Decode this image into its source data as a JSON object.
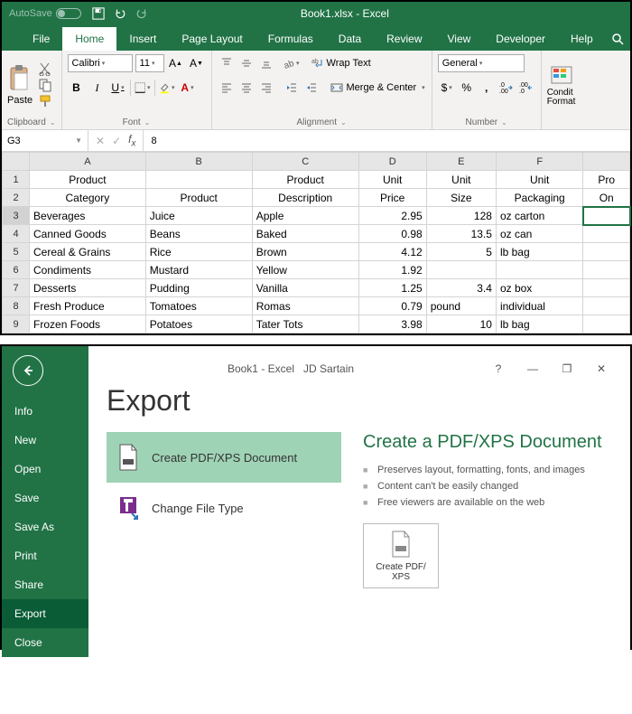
{
  "titlebar": {
    "autosave": "AutoSave",
    "title": "Book1.xlsx - Excel"
  },
  "tabs": [
    "File",
    "Home",
    "Insert",
    "Page Layout",
    "Formulas",
    "Data",
    "Review",
    "View",
    "Developer",
    "Help"
  ],
  "active_tab": "Home",
  "ribbon": {
    "clipboard": {
      "paste": "Paste",
      "label": "Clipboard"
    },
    "font": {
      "name": "Calibri",
      "size": "11",
      "b": "B",
      "i": "I",
      "u": "U",
      "label": "Font"
    },
    "alignment": {
      "wrap": "Wrap Text",
      "merge": "Merge & Center",
      "label": "Alignment"
    },
    "number": {
      "format": "General",
      "currency": "$",
      "percent": "%",
      "comma": ",",
      "inc": ".0→",
      "dec": "→.0",
      "label": "Number"
    },
    "styles": {
      "condfmt": "Condit\nFormat"
    }
  },
  "formula_bar": {
    "name_box": "G3",
    "value": "8"
  },
  "columns": [
    "A",
    "B",
    "C",
    "D",
    "E",
    "F",
    ""
  ],
  "header_rows": [
    [
      "Product",
      "",
      "Product",
      "Unit",
      "Unit",
      "Unit",
      "Pro"
    ],
    [
      "Category",
      "Product",
      "Description",
      "Price",
      "Size",
      "Packaging",
      "On"
    ]
  ],
  "data_rows": [
    [
      "Beverages",
      "Juice",
      "Apple",
      "2.95",
      "128",
      "oz carton",
      ""
    ],
    [
      "Canned Goods",
      "Beans",
      "Baked",
      "0.98",
      "13.5",
      "oz can",
      ""
    ],
    [
      "Cereal & Grains",
      "Rice",
      "Brown",
      "4.12",
      "5",
      "lb bag",
      ""
    ],
    [
      "Condiments",
      "Mustard",
      "Yellow",
      "1.92",
      "",
      "",
      ""
    ],
    [
      "Desserts",
      "Pudding",
      "Vanilla",
      "1.25",
      "3.4",
      "oz box",
      ""
    ],
    [
      "Fresh Produce",
      "Tomatoes",
      "Romas",
      "0.79",
      "pound",
      "individual",
      ""
    ],
    [
      "Frozen Foods",
      "Potatoes",
      "Tater Tots",
      "3.98",
      "10",
      "lb bag",
      ""
    ]
  ],
  "backstage": {
    "title_center": "Book1  -  Excel",
    "user": "JD Sartain",
    "nav": [
      "Info",
      "New",
      "Open",
      "Save",
      "Save As",
      "Print",
      "Share",
      "Export",
      "Close"
    ],
    "active_nav": "Export",
    "heading": "Export",
    "options": [
      {
        "label": "Create PDF/XPS Document",
        "selected": true
      },
      {
        "label": "Change File Type",
        "selected": false
      }
    ],
    "detail": {
      "heading": "Create a PDF/XPS Document",
      "bullets": [
        "Preserves layout, formatting, fonts, and images",
        "Content can't be easily changed",
        "Free viewers are available on the web"
      ],
      "button": "Create PDF/\nXPS"
    }
  }
}
